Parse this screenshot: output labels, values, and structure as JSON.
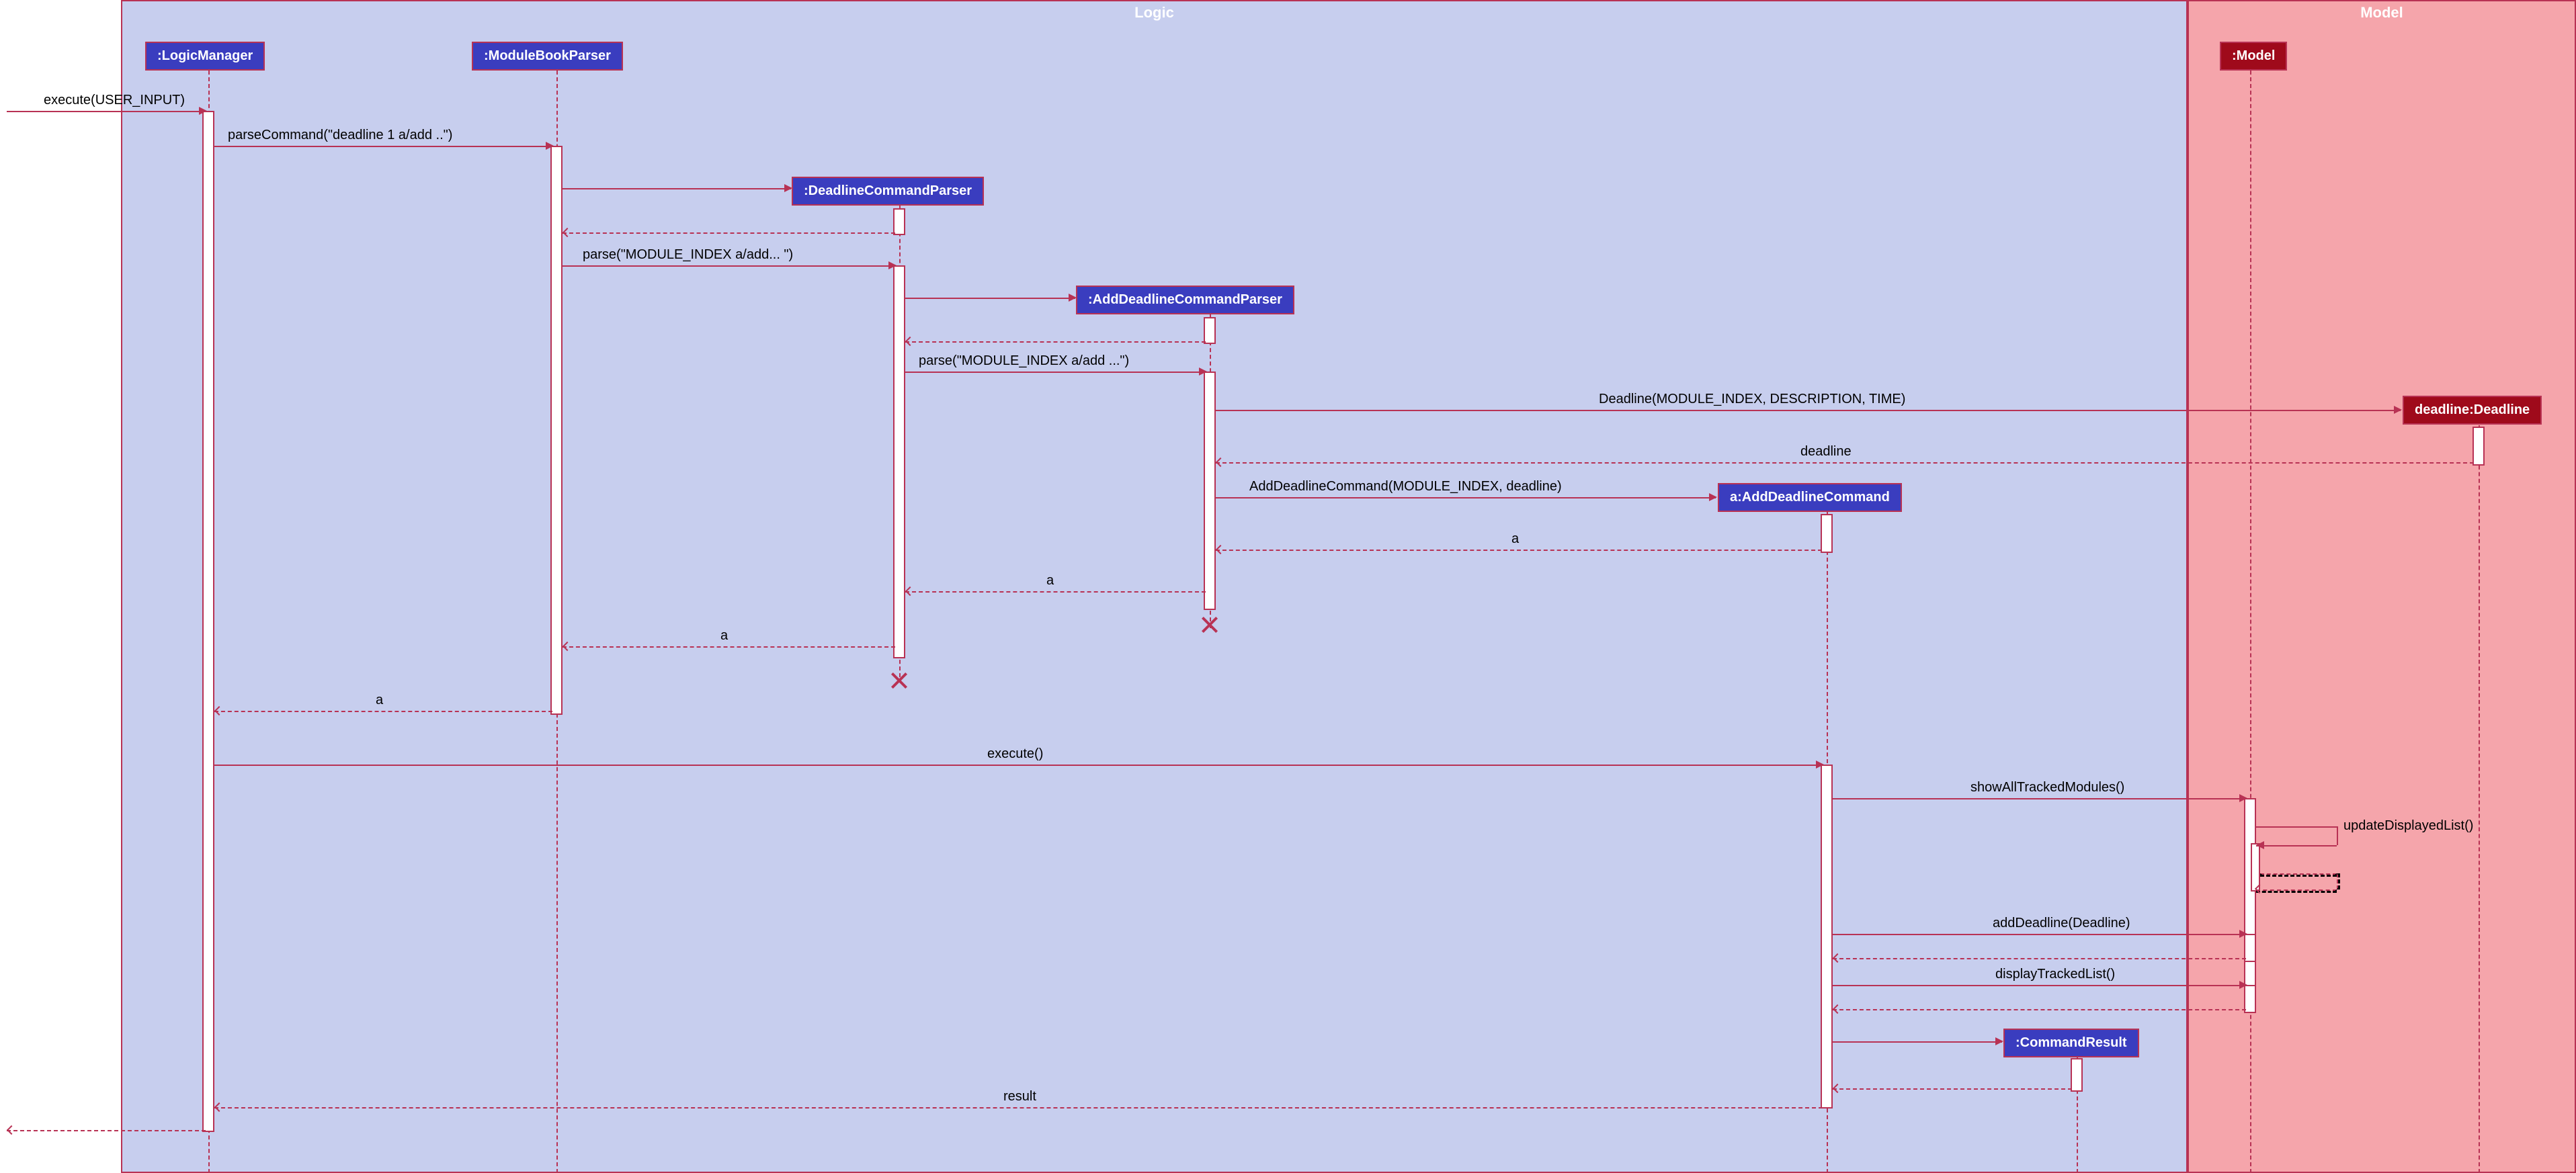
{
  "regions": {
    "logic": {
      "title": "Logic"
    },
    "model": {
      "title": "Model"
    }
  },
  "participants": {
    "logicManager": ":LogicManager",
    "moduleBookParser": ":ModuleBookParser",
    "deadlineCommandParser": ":DeadlineCommandParser",
    "addDeadlineCommandParser": ":AddDeadlineCommandParser",
    "addDeadlineCommand": "a:AddDeadlineCommand",
    "commandResult": ":CommandResult",
    "model": ":Model",
    "deadline": "deadline:Deadline"
  },
  "messages": {
    "m_execute_input": "execute(USER_INPUT)",
    "m_parseCommand": "parseCommand(\"deadline 1 a/add ..\")",
    "m_parse1": "parse(\"MODULE_INDEX a/add... \")",
    "m_parse2": "parse(\"MODULE_INDEX a/add ...\")",
    "m_deadlineCtor": "Deadline(MODULE_INDEX, DESCRIPTION, TIME)",
    "m_deadlineReturn": "deadline",
    "m_addDeadlineCmdCtor": "AddDeadlineCommand(MODULE_INDEX, deadline)",
    "m_a1": "a",
    "m_a2": "a",
    "m_a3": "a",
    "m_a4": "a",
    "m_execute": "execute()",
    "m_showAll": "showAllTrackedModules()",
    "m_updateDisplayed": "updateDisplayedList()",
    "m_addDeadline": "addDeadline(Deadline)",
    "m_displayTracked": "displayTrackedList()",
    "m_result": "result"
  }
}
